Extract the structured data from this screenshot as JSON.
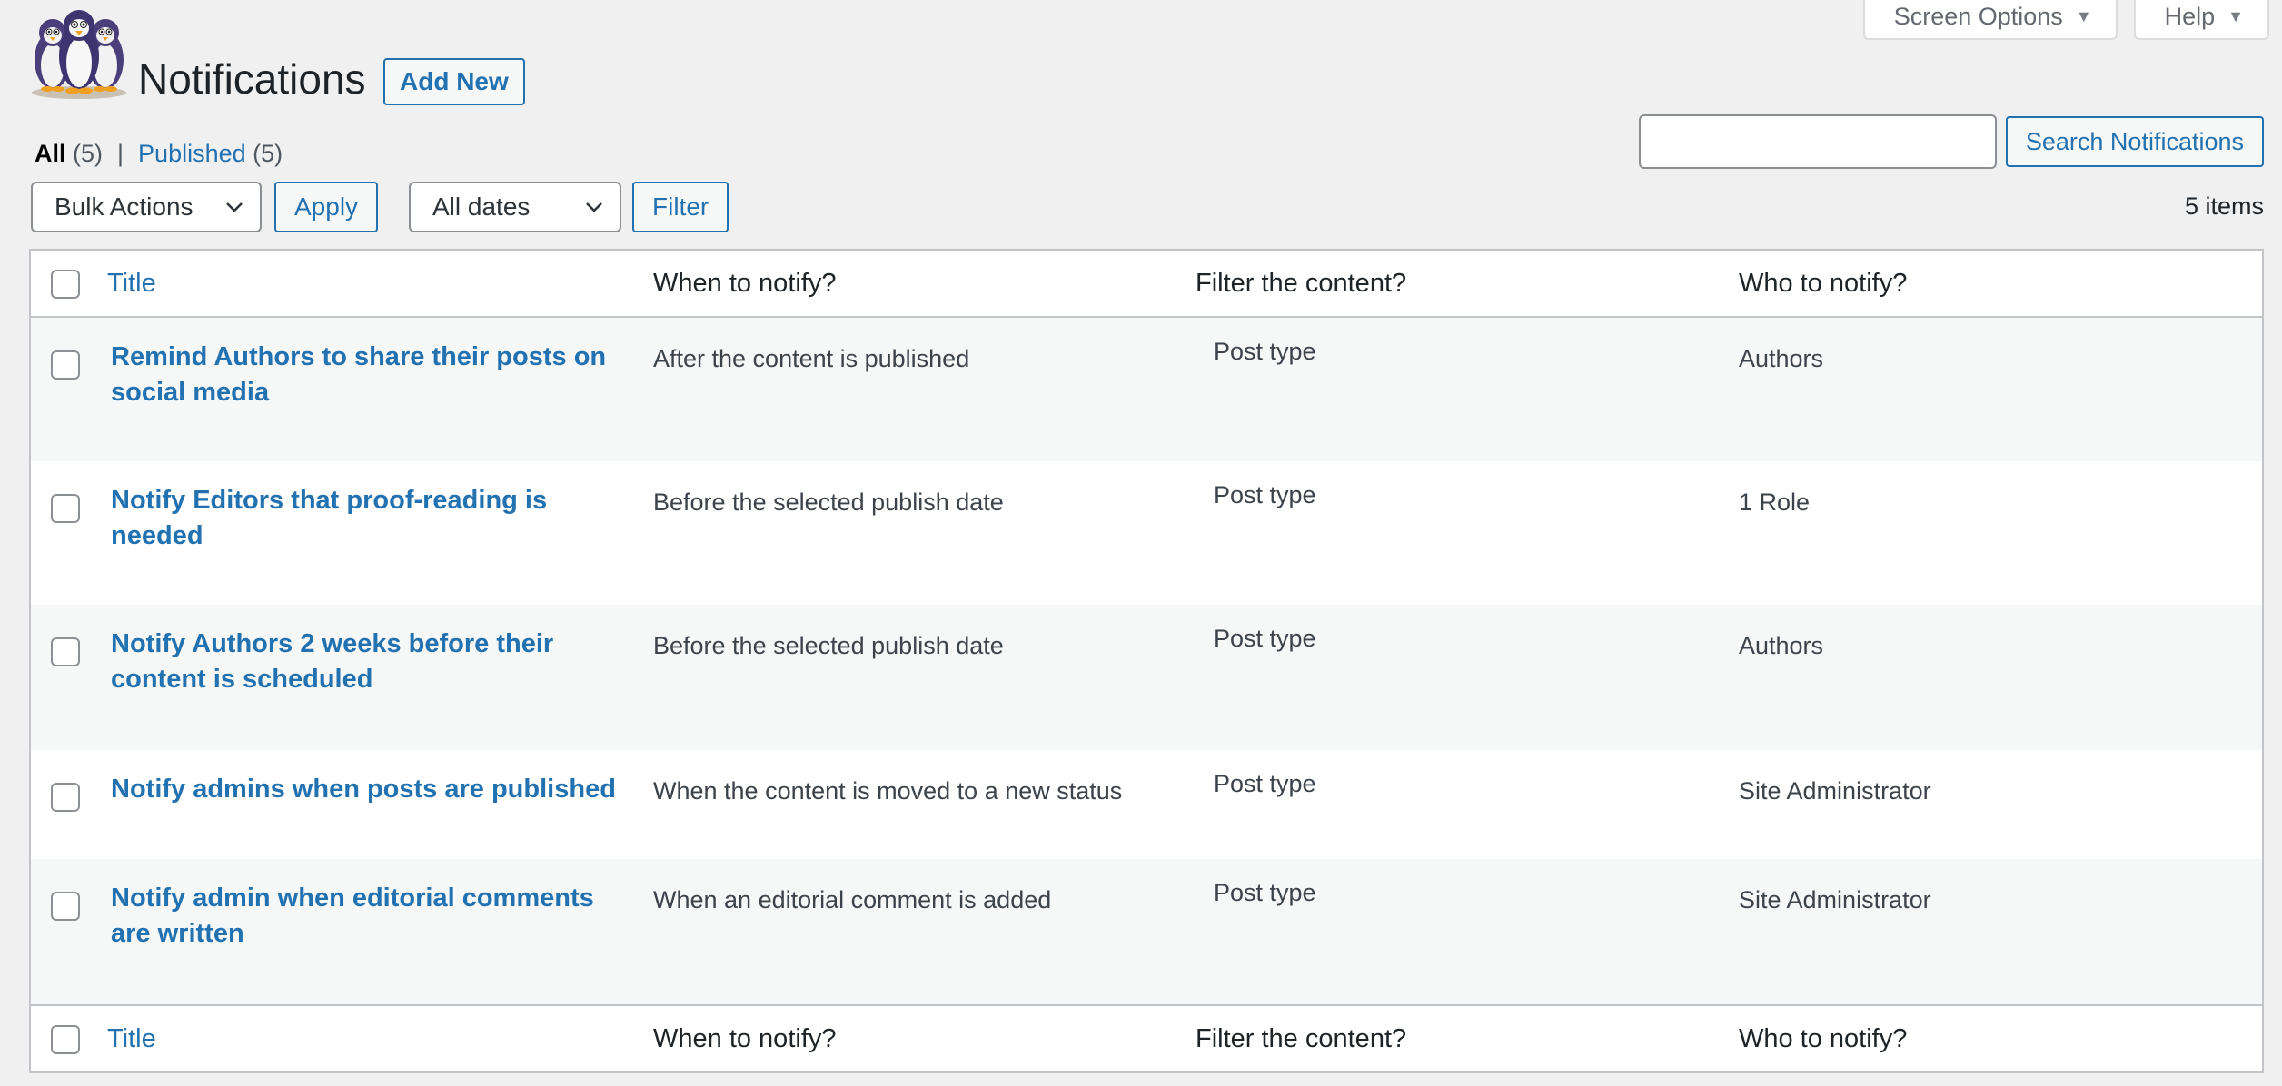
{
  "screen_meta": {
    "screen_options": "Screen Options",
    "help": "Help"
  },
  "header": {
    "title": "Notifications",
    "add_new": "Add New"
  },
  "views": {
    "all_label": "All",
    "all_count": "(5)",
    "separator": "|",
    "published_label": "Published",
    "published_count": "(5)"
  },
  "search": {
    "value": "",
    "button": "Search Notifications"
  },
  "tablenav": {
    "bulk_actions": "Bulk Actions",
    "apply": "Apply",
    "dates": "All dates",
    "filter": "Filter",
    "items": "5 items"
  },
  "columns": {
    "title": "Title",
    "when": "When to notify?",
    "filter": "Filter the content?",
    "who": "Who to notify?"
  },
  "rows": [
    {
      "title_line1": "Remind Authors to share their posts on",
      "title_line2": "social media",
      "when": "After the content is published",
      "filter": "Post type",
      "who": "Authors"
    },
    {
      "title_line1": "Notify Editors that proof-reading is",
      "title_line2": "needed",
      "when": "Before the selected publish date",
      "filter": "Post type",
      "who": "1 Role"
    },
    {
      "title_line1": "Notify Authors 2 weeks before their",
      "title_line2": "content is scheduled",
      "when": "Before the selected publish date",
      "filter": "Post type",
      "who": "Authors"
    },
    {
      "title_line1": "Notify admins when posts are published",
      "title_line2": "",
      "when": "When the content is moved to a new status",
      "filter": "Post type",
      "who": "Site Administrator"
    },
    {
      "title_line1": "Notify admin when editorial comments",
      "title_line2": "are written",
      "when": "When an editorial comment is added",
      "filter": "Post type",
      "who": "Site Administrator"
    }
  ],
  "colors": {
    "link": "#2271b1",
    "background": "#f0f0f1",
    "border": "#c3c4c7",
    "alt_row": "#f6f7f7"
  },
  "icons": [
    "penguins-logo",
    "caret-down-icon",
    "chevron-down-icon",
    "checkbox"
  ]
}
